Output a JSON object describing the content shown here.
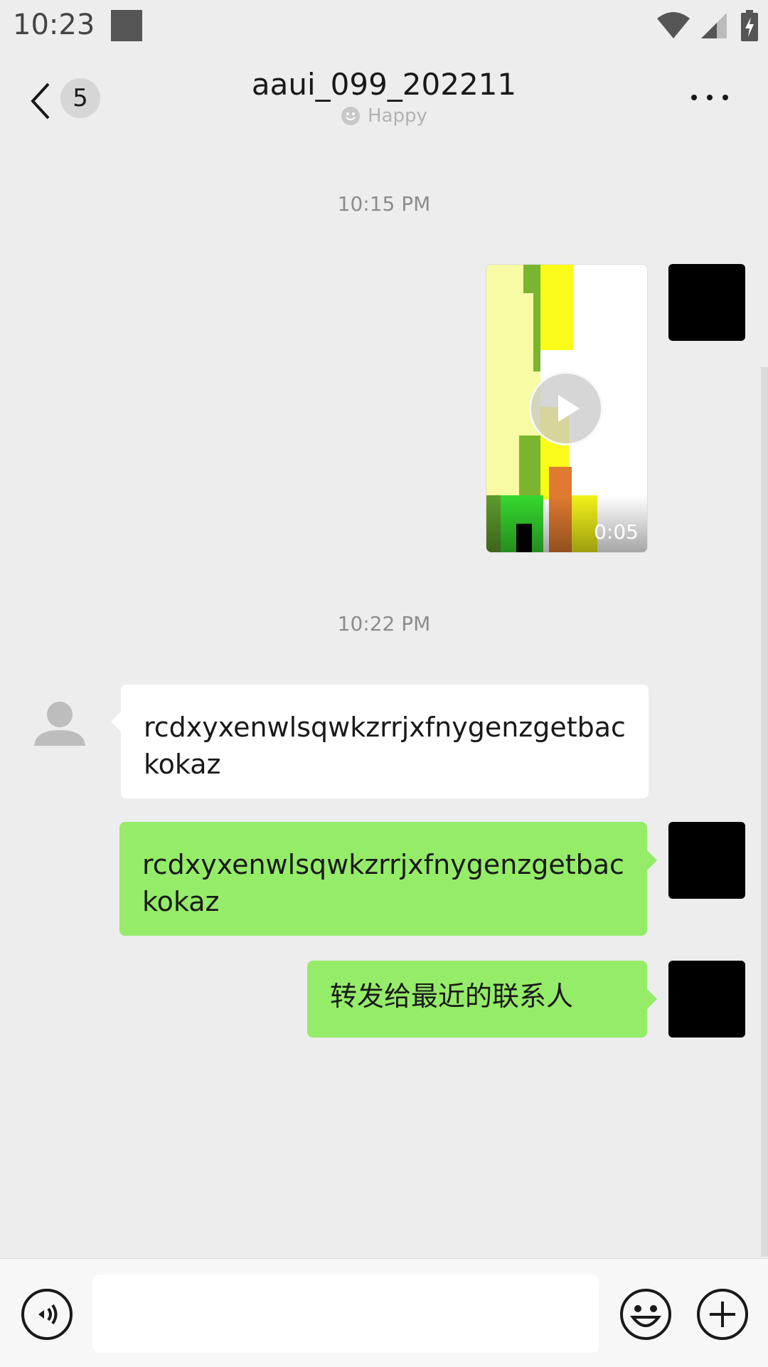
{
  "status_bar": {
    "time": "10:23"
  },
  "header": {
    "unread_count": "5",
    "title": "aaui_099_202211",
    "status_text": "Happy"
  },
  "messages": {
    "timestamp_1": "10:15 PM",
    "video": {
      "duration": "0:05"
    },
    "timestamp_2": "10:22 PM",
    "incoming_text": "rcdxyxenwlsqwkzrrjxfnygenzgetbackokaz",
    "outgoing_text_1": "rcdxyxenwlsqwkzrrjxfnygenzgetbackokaz",
    "outgoing_text_2": "转发给最近的联系人"
  },
  "colors": {
    "outgoing_bubble": "#95ec69",
    "incoming_bubble": "#ffffff",
    "background": "#ededed"
  }
}
